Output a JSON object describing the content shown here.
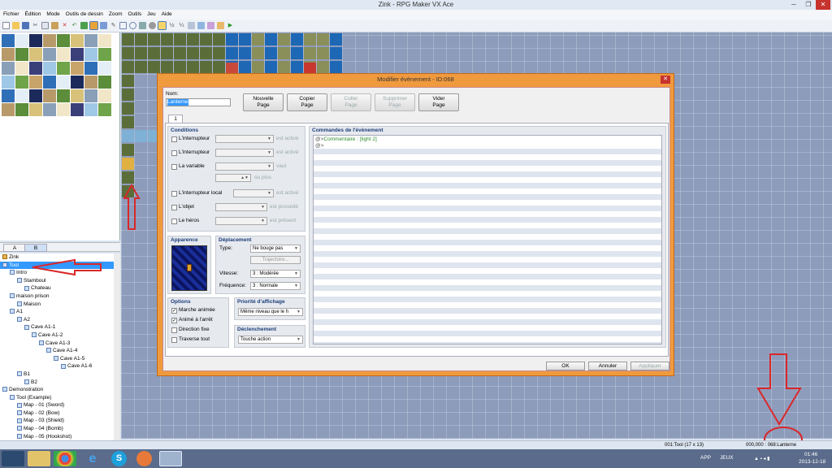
{
  "window": {
    "title": "Zink - RPG Maker VX Ace",
    "controls": [
      "─",
      "❐",
      "✕"
    ]
  },
  "menu": [
    "Fichier",
    "Édition",
    "Mode",
    "Outils de dessin",
    "Zoom",
    "Outils",
    "Jeu",
    "Aide"
  ],
  "toolbar_icons": [
    "new-icon",
    "open-icon",
    "save-icon",
    "cut-icon",
    "copy-icon",
    "paste-icon",
    "delete-icon",
    "undo-icon",
    "map-layer-icon",
    "event-layer-icon",
    "region-icon",
    "pencil-icon",
    "rectangle-icon",
    "ellipse-icon",
    "fill-icon",
    "shadow-pen-icon",
    "zoom-1-icon",
    "zoom-2-icon",
    "zoom-4-icon",
    "database-icon",
    "resource-manager-icon",
    "script-editor-icon",
    "sound-test-icon",
    "playtest-icon"
  ],
  "palette_tabs": [
    "A",
    "B"
  ],
  "maptree": [
    {
      "label": "Zink",
      "depth": 0,
      "type": "project"
    },
    {
      "label": "Tool",
      "depth": 0,
      "type": "map",
      "selected": true
    },
    {
      "label": "Intro",
      "depth": 1,
      "type": "map"
    },
    {
      "label": "Stamboul",
      "depth": 2,
      "type": "map"
    },
    {
      "label": "Chateau",
      "depth": 3,
      "type": "map"
    },
    {
      "label": "maison prison",
      "depth": 1,
      "type": "map"
    },
    {
      "label": "Maison",
      "depth": 2,
      "type": "map"
    },
    {
      "label": "A1",
      "depth": 1,
      "type": "map"
    },
    {
      "label": "A2",
      "depth": 2,
      "type": "map"
    },
    {
      "label": "Cave A1-1",
      "depth": 3,
      "type": "map"
    },
    {
      "label": "Cave A1-2",
      "depth": 4,
      "type": "map"
    },
    {
      "label": "Cave A1-3",
      "depth": 5,
      "type": "map"
    },
    {
      "label": "Cave A1-4",
      "depth": 6,
      "type": "map"
    },
    {
      "label": "Cave A1-5",
      "depth": 7,
      "type": "map"
    },
    {
      "label": "Cave A1-6",
      "depth": 8,
      "type": "map"
    },
    {
      "label": "B1",
      "depth": 2,
      "type": "map"
    },
    {
      "label": "B2",
      "depth": 3,
      "type": "map"
    },
    {
      "label": "Demonstration",
      "depth": 0,
      "type": "map"
    },
    {
      "label": "Tool (Example)",
      "depth": 1,
      "type": "map"
    },
    {
      "label": "Map - 01 (Sword)",
      "depth": 2,
      "type": "map"
    },
    {
      "label": "Map - 02 (Bow)",
      "depth": 2,
      "type": "map"
    },
    {
      "label": "Map - 03 (Shield)",
      "depth": 2,
      "type": "map"
    },
    {
      "label": "Map - 04 (Bomb)",
      "depth": 2,
      "type": "map"
    },
    {
      "label": "Map - 05 (Hookshot)",
      "depth": 2,
      "type": "map"
    }
  ],
  "dialog": {
    "title": "Modifier évènement - ID:068",
    "name_label": "Nom:",
    "name_value": "Lanterne",
    "page_buttons": [
      {
        "line1": "Nouvelle",
        "line2": "Page",
        "enabled": true
      },
      {
        "line1": "Copier",
        "line2": "Page",
        "enabled": true
      },
      {
        "line1": "Coller",
        "line2": "Page",
        "enabled": false
      },
      {
        "line1": "Supprimer",
        "line2": "Page",
        "enabled": false
      },
      {
        "line1": "Vider",
        "line2": "Page",
        "enabled": true
      }
    ],
    "page_tab": "1",
    "conditions": {
      "title": "Conditions",
      "switch1": "L'interrupteur",
      "switch1_suffix": "est activé",
      "switch2": "L'interrupteur",
      "switch2_suffix": "est activé",
      "variable": "La variable",
      "variable_suffix": "vaut",
      "variable_or_more": "ou plus",
      "self_switch": "L'interrupteur local",
      "self_switch_suffix": "est activé",
      "item": "L'objet",
      "item_suffix": "est possédé",
      "actor": "Le héros",
      "actor_suffix": "est présent"
    },
    "graphic": {
      "title": "Apparence"
    },
    "movement": {
      "title": "Déplacement",
      "type_label": "Type:",
      "type_value": "Ne bouge pas",
      "route_button": "Trajectoire...",
      "speed_label": "Vitesse:",
      "speed_value": "3 : Modérée",
      "freq_label": "Fréquence:",
      "freq_value": "3 : Normale"
    },
    "options": {
      "title": "Options",
      "items": [
        {
          "label": "Marche animée",
          "checked": true
        },
        {
          "label": "Animé à l'arrêt",
          "checked": true
        },
        {
          "label": "Direction fixe",
          "checked": false
        },
        {
          "label": "Traverse tout",
          "checked": false
        }
      ]
    },
    "priority": {
      "title": "Priorité d'affichage",
      "value": "Même niveau que le h"
    },
    "trigger": {
      "title": "Déclenchement",
      "value": "Touche action"
    },
    "commands": {
      "title": "Commandes de l'évènement",
      "lines": [
        {
          "marker": "@>",
          "text": "Commentaire : [light 2]"
        },
        {
          "marker": "@>",
          "text": ""
        }
      ]
    },
    "ok": "OK",
    "cancel": "Annuler",
    "apply": "Appliquer"
  },
  "status": {
    "map": "001:Tool (17 x 13)",
    "position": "000,000 : 068:Lanterne"
  },
  "taskbar": {
    "lang": "APP",
    "games": "JEUX",
    "time": "01:46",
    "date": "2013-12-18"
  },
  "colors": {
    "accent_red": "#d9282a",
    "dialog_border": "#f09a3e",
    "selection": "#3399ff",
    "water": "#1d67b5"
  }
}
